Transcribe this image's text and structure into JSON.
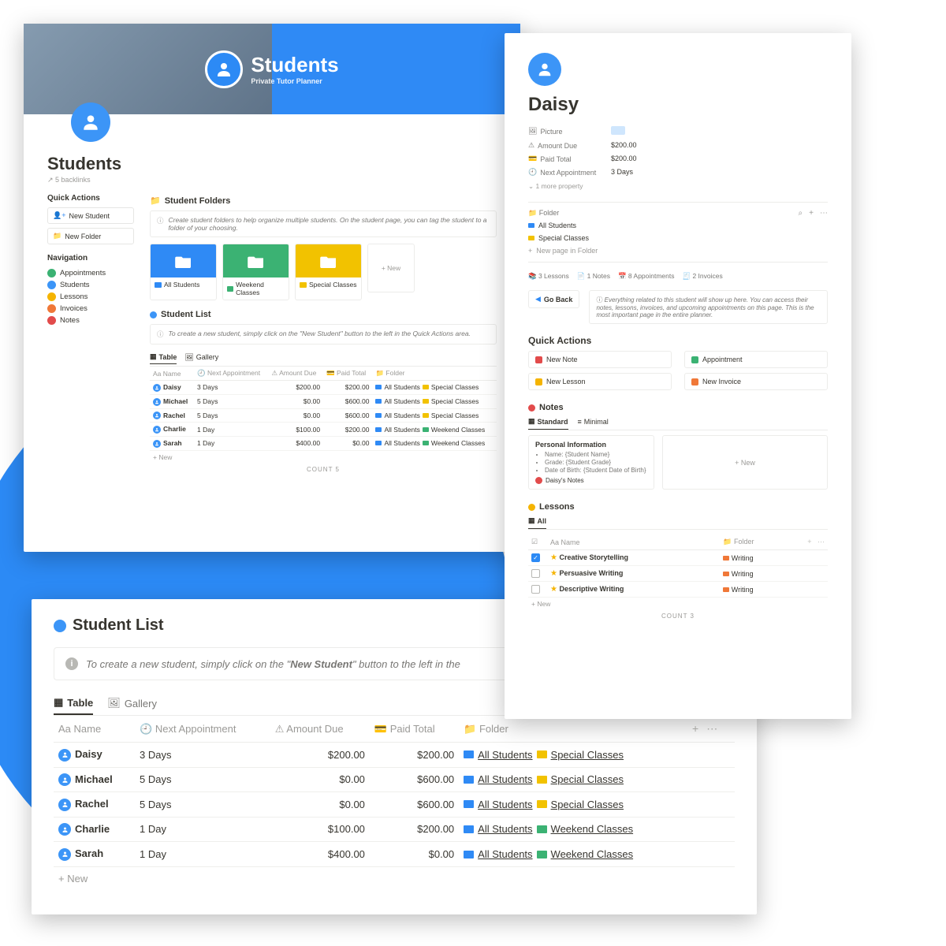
{
  "hero": {
    "title": "Students",
    "subtitle": "Private Tutor Planner"
  },
  "page": {
    "title": "Students",
    "backlinks": "5 backlinks"
  },
  "quickActions": {
    "title": "Quick Actions",
    "newStudent": "New Student",
    "newFolder": "New Folder"
  },
  "navigation": {
    "title": "Navigation",
    "items": [
      {
        "label": "Appointments",
        "color": "#3bb273"
      },
      {
        "label": "Students",
        "color": "#3c95f7"
      },
      {
        "label": "Lessons",
        "color": "#f5b400"
      },
      {
        "label": "Invoices",
        "color": "#f07838"
      },
      {
        "label": "Notes",
        "color": "#e24b4b"
      }
    ]
  },
  "studentFolders": {
    "title": "Student Folders",
    "info": "Create student folders to help organize multiple students. On the student page, you can tag the student to a folder of your choosing.",
    "cards": [
      {
        "label": "All Students",
        "bg": "#2f8af5",
        "chip": "#2f8af5"
      },
      {
        "label": "Weekend Classes",
        "bg": "#3bb273",
        "chip": "#3bb273"
      },
      {
        "label": "Special Classes",
        "bg": "#f2c200",
        "chip": "#f2c200"
      }
    ],
    "newLabel": "+  New"
  },
  "studentListMini": {
    "title": "Student List",
    "info": "To create a new student, simply click on the \"New Student\" button to the left in the Quick Actions area.",
    "tabs": {
      "table": "Table",
      "gallery": "Gallery"
    },
    "cols": {
      "name": "Name",
      "next": "Next Appointment",
      "due": "Amount Due",
      "paid": "Paid Total",
      "folder": "Folder"
    },
    "rows": [
      {
        "name": "Daisy",
        "next": "3 Days",
        "due": "$200.00",
        "paid": "$200.00",
        "f1": "All Students",
        "c1": "#2f8af5",
        "f2": "Special Classes",
        "c2": "#f2c200"
      },
      {
        "name": "Michael",
        "next": "5 Days",
        "due": "$0.00",
        "paid": "$600.00",
        "f1": "All Students",
        "c1": "#2f8af5",
        "f2": "Special Classes",
        "c2": "#f2c200"
      },
      {
        "name": "Rachel",
        "next": "5 Days",
        "due": "$0.00",
        "paid": "$600.00",
        "f1": "All Students",
        "c1": "#2f8af5",
        "f2": "Special Classes",
        "c2": "#f2c200"
      },
      {
        "name": "Charlie",
        "next": "1 Day",
        "due": "$100.00",
        "paid": "$200.00",
        "f1": "All Students",
        "c1": "#2f8af5",
        "f2": "Weekend Classes",
        "c2": "#3bb273"
      },
      {
        "name": "Sarah",
        "next": "1 Day",
        "due": "$400.00",
        "paid": "$0.00",
        "f1": "All Students",
        "c1": "#2f8af5",
        "f2": "Weekend Classes",
        "c2": "#3bb273"
      }
    ],
    "newRow": "+  New",
    "count": "COUNT 5"
  },
  "daisy": {
    "title": "Daisy",
    "props": {
      "picture": "Picture",
      "amountDueL": "Amount Due",
      "amountDueV": "$200.00",
      "paidTotalL": "Paid Total",
      "paidTotalV": "$200.00",
      "nextL": "Next Appointment",
      "nextV": "3 Days",
      "more": "1 more property"
    },
    "folder": {
      "label": "Folder",
      "items": [
        "All Students",
        "Special Classes"
      ],
      "colors": [
        "#2f8af5",
        "#f2c200"
      ],
      "new": "New page in Folder"
    },
    "stats": {
      "lessons": "3 Lessons",
      "notes": "1 Notes",
      "appts": "8 Appointments",
      "invoices": "2 Invoices"
    },
    "goBack": "Go Back",
    "desc": "Everything related to this student will show up here. You can access their notes, lessons, invoices, and upcoming appointments on this page. This is the most important page in the entire planner.",
    "qaTitle": "Quick Actions",
    "qa": {
      "newNote": "New Note",
      "appointment": "Appointment",
      "newLesson": "New Lesson",
      "newInvoice": "New Invoice"
    },
    "notes": {
      "title": "Notes",
      "tabStandard": "Standard",
      "tabMinimal": "Minimal",
      "card": {
        "title": "Personal Information",
        "l1": "Name: {Student Name}",
        "l2": "Grade: {Student Grade}",
        "l3": "Date of Birth: {Student Date of Birth}",
        "footer": "Daisy's Notes"
      },
      "empty": "+  New"
    },
    "lessons": {
      "title": "Lessons",
      "tabAll": "All",
      "cols": {
        "chk": "",
        "name": "Name",
        "folder": "Folder"
      },
      "rows": [
        {
          "done": true,
          "name": "Creative Storytelling",
          "folder": "Writing"
        },
        {
          "done": false,
          "name": "Persuasive Writing",
          "folder": "Writing"
        },
        {
          "done": false,
          "name": "Descriptive Writing",
          "folder": "Writing"
        }
      ],
      "new": "+  New",
      "count": "COUNT 3"
    }
  },
  "bigList": {
    "title": "Student List",
    "infoPrefix": "To create a new student, simply click on the \"",
    "infoBold": "New Student",
    "infoSuffix": "\" button to the left in the",
    "tabs": {
      "table": "Table",
      "gallery": "Gallery"
    },
    "cols": {
      "name": "Name",
      "next": "Next Appointment",
      "due": "Amount Due",
      "paid": "Paid Total",
      "folder": "Folder"
    },
    "rows": [
      {
        "name": "Daisy",
        "next": "3 Days",
        "due": "$200.00",
        "paid": "$200.00",
        "f1": "All Students",
        "c1": "#2f8af5",
        "f2": "Special Classes",
        "c2": "#f2c200"
      },
      {
        "name": "Michael",
        "next": "5 Days",
        "due": "$0.00",
        "paid": "$600.00",
        "f1": "All Students",
        "c1": "#2f8af5",
        "f2": "Special Classes",
        "c2": "#f2c200"
      },
      {
        "name": "Rachel",
        "next": "5 Days",
        "due": "$0.00",
        "paid": "$600.00",
        "f1": "All Students",
        "c1": "#2f8af5",
        "f2": "Special Classes",
        "c2": "#f2c200"
      },
      {
        "name": "Charlie",
        "next": "1 Day",
        "due": "$100.00",
        "paid": "$200.00",
        "f1": "All Students",
        "c1": "#2f8af5",
        "f2": "Weekend Classes",
        "c2": "#3bb273"
      },
      {
        "name": "Sarah",
        "next": "1 Day",
        "due": "$400.00",
        "paid": "$0.00",
        "f1": "All Students",
        "c1": "#2f8af5",
        "f2": "Weekend Classes",
        "c2": "#3bb273"
      }
    ],
    "newRow": "+  New"
  }
}
